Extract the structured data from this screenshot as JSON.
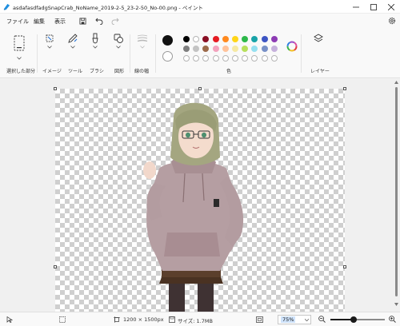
{
  "window": {
    "title": "asdafasdfadgSnapCrab_NoName_2019-2-5_23-2-50_No-00.png - ペイント"
  },
  "menu": {
    "file": "ファイル",
    "edit": "編集",
    "view": "表示"
  },
  "ribbon": {
    "selection_label": "選択した部分",
    "image_label": "イメージ",
    "tools_label": "ツール",
    "brushes_label": "ブラシ",
    "shapes_label": "図形",
    "line_width_label": "線の幅",
    "colors_label": "色",
    "layers_label": "レイヤー"
  },
  "colors": {
    "primary": "#111111",
    "secondary": "#ffffff",
    "palette_row1": [
      "#000000",
      "#ffffff",
      "#8a0f24",
      "#e51c23",
      "#ff8a1f",
      "#ffd518",
      "#2db84a",
      "#18a3a8",
      "#3d55c4",
      "#8d3bb4"
    ],
    "palette_row2": [
      "#7f7f7f",
      "#c3c3c3",
      "#9c6a4a",
      "#f3a2bd",
      "#ffc39b",
      "#f6e9a3",
      "#b7e05c",
      "#95e0f0",
      "#7890c7",
      "#c6b1dc"
    ],
    "palette_row3_empty": 10
  },
  "status": {
    "dimensions": "1200 × 1500px",
    "file_size": "サイズ: 1.7MB",
    "zoom": "75%",
    "zoom_level_fraction": 0.42
  }
}
